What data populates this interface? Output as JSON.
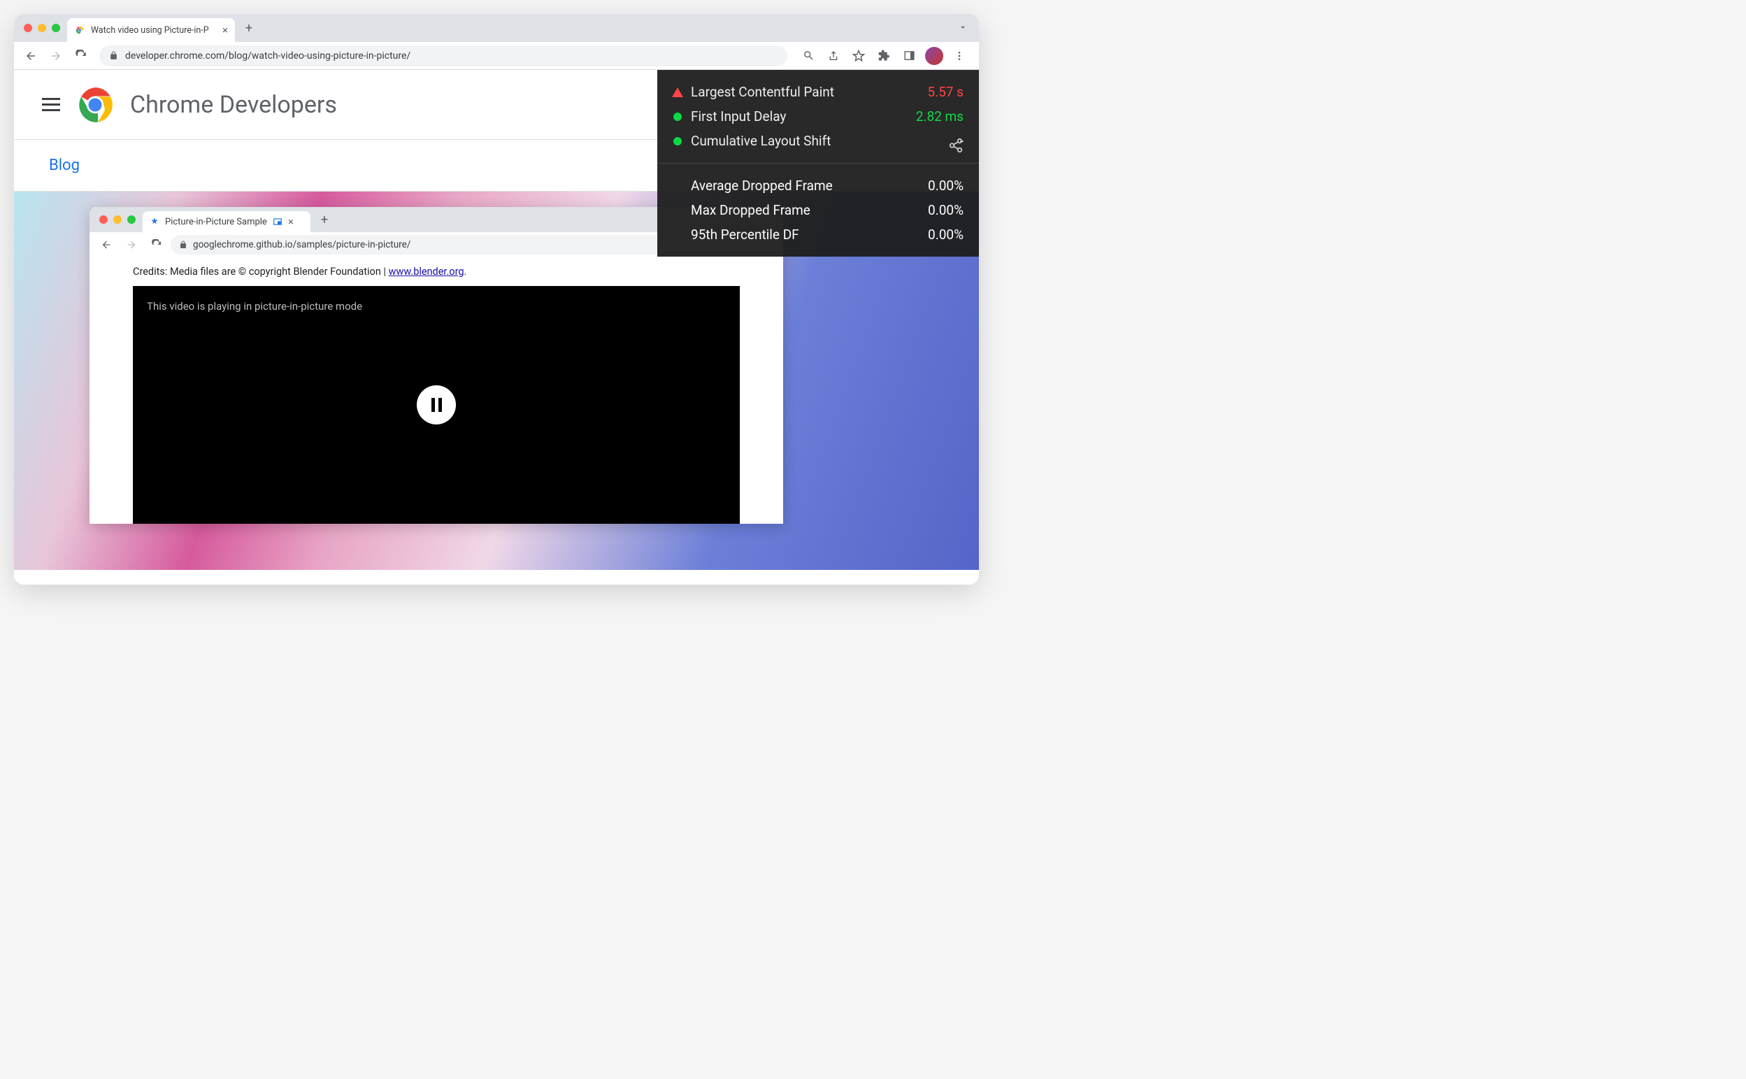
{
  "browser": {
    "tab_title": "Watch video using Picture-in-P",
    "url": "developer.chrome.com/blog/watch-video-using-picture-in-picture/"
  },
  "site": {
    "title": "Chrome Developers",
    "breadcrumb": "Blog"
  },
  "inner_browser": {
    "tab_title": "Picture-in-Picture Sample",
    "url": "googlechrome.github.io/samples/picture-in-picture/",
    "credits_prefix": "Credits: Media files are © copyright Blender Foundation | ",
    "credits_link": "www.blender.org",
    "credits_suffix": ".",
    "video_msg": "This video is playing in picture-in-picture mode"
  },
  "metrics": {
    "vitals": [
      {
        "label": "Largest Contentful Paint",
        "value": "5.57 s",
        "status": "bad"
      },
      {
        "label": "First Input Delay",
        "value": "2.82 ms",
        "status": "good"
      },
      {
        "label": "Cumulative Layout Shift",
        "value": "-",
        "status": "good"
      }
    ],
    "frames": [
      {
        "label": "Average Dropped Frame",
        "value": "0.00%"
      },
      {
        "label": "Max Dropped Frame",
        "value": "0.00%"
      },
      {
        "label": "95th Percentile DF",
        "value": "0.00%"
      }
    ]
  }
}
